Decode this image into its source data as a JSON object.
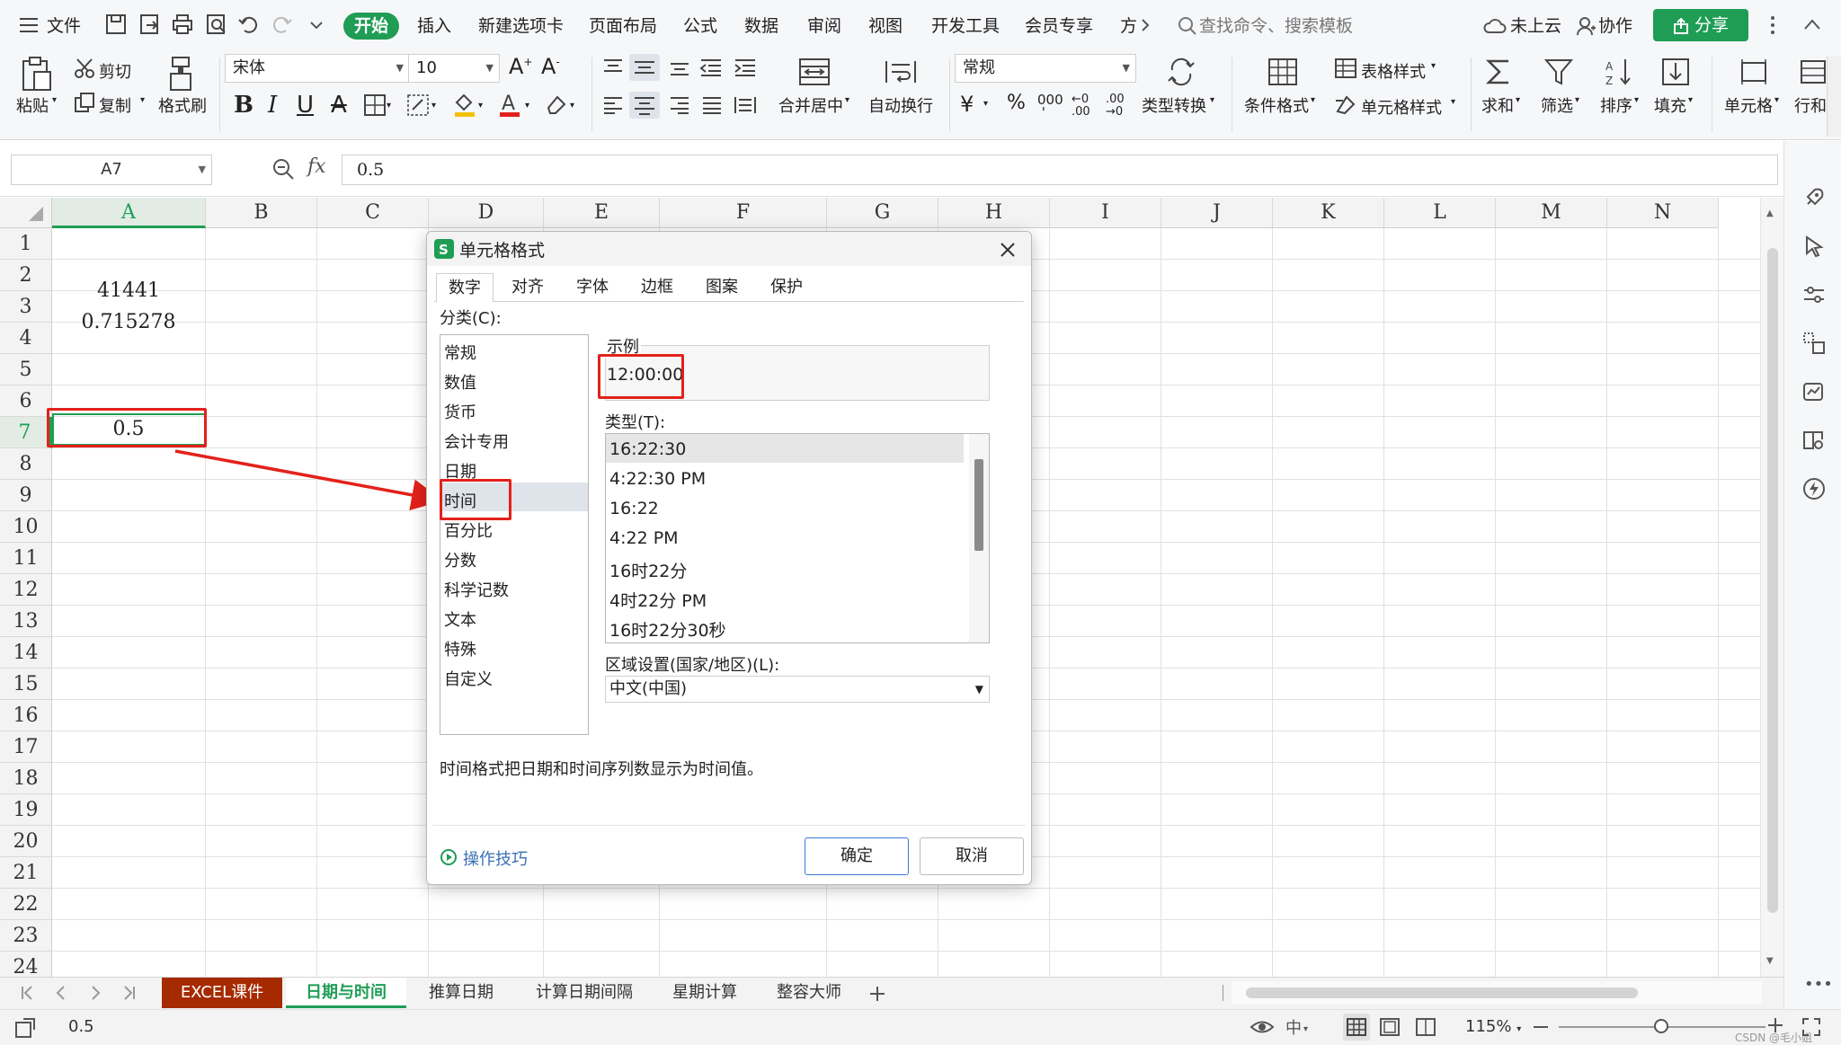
{
  "menubar": {
    "file_label": "文件",
    "tabs": [
      "开始",
      "插入",
      "新建选项卡",
      "页面布局",
      "公式",
      "数据",
      "审阅",
      "视图",
      "开发工具",
      "会员专享",
      "方"
    ],
    "search_placeholder": "查找命令、搜索模板",
    "cloud_label": "未上云",
    "collab_label": "协作",
    "share_label": "分享"
  },
  "ribbon": {
    "paste": "粘贴",
    "cut": "剪切",
    "copy": "复制",
    "format_painter": "格式刷",
    "font_name": "宋体",
    "font_size": "10",
    "number_format": "常规",
    "merge": "合并居中",
    "wrap": "自动换行",
    "type_convert": "类型转换",
    "cond_format": "条件格式",
    "table_style": "表格样式",
    "cell_style": "单元格样式",
    "sum": "求和",
    "filter": "筛选",
    "sort": "排序",
    "fill": "填充",
    "cell": "单元格",
    "rowcol": "行和"
  },
  "formula": {
    "name_box": "A7",
    "fx": "fx",
    "value": "0.5"
  },
  "grid": {
    "columns": [
      "A",
      "B",
      "C",
      "D",
      "E",
      "F",
      "G",
      "H",
      "I",
      "J",
      "K",
      "L",
      "M",
      "N"
    ],
    "rows": [
      "1",
      "2",
      "3",
      "4",
      "5",
      "6",
      "7",
      "8",
      "9",
      "10",
      "11",
      "12",
      "13",
      "14",
      "15",
      "16",
      "17",
      "18",
      "19",
      "20",
      "21",
      "22",
      "23",
      "24"
    ],
    "cells": {
      "a2": "41441",
      "a3": "0.715278",
      "a7": "0.5"
    }
  },
  "sheet_tabs": [
    "EXCEL课件",
    "日期与时间",
    "推算日期",
    "计算日期间隔",
    "星期计算",
    "整容大师"
  ],
  "status": {
    "value": "0.5",
    "zoom": "115%",
    "watermark": "CSDN @毛小姐"
  },
  "dialog": {
    "title": "单元格格式",
    "tabs": [
      "数字",
      "对齐",
      "字体",
      "边框",
      "图案",
      "保护"
    ],
    "category_label": "分类(C):",
    "categories": [
      "常规",
      "数值",
      "货币",
      "会计专用",
      "日期",
      "时间",
      "百分比",
      "分数",
      "科学记数",
      "文本",
      "特殊",
      "自定义"
    ],
    "sample_label": "示例",
    "sample_value": "12:00:00",
    "type_label": "类型(T):",
    "types": [
      "16:22:30",
      "4:22:30 PM",
      "16:22",
      "4:22 PM",
      "16时22分",
      "4时22分 PM",
      "16时22分30秒"
    ],
    "locale_label": "区域设置(国家/地区)(L):",
    "locale_value": "中文(中国)",
    "description": "时间格式把日期和时间序列数显示为时间值。",
    "tips_label": "操作技巧",
    "ok_label": "确定",
    "cancel_label": "取消"
  },
  "colors": {
    "accent_green": "#1f9d55",
    "annotation_red": "#e3211b",
    "sheet_tab_active": "#a52a00"
  }
}
